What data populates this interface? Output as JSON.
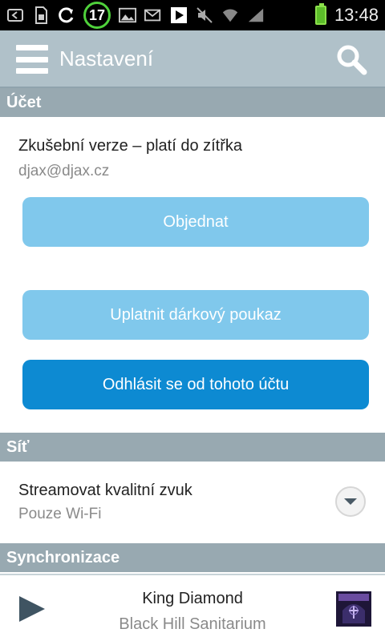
{
  "status_bar": {
    "badge": "17",
    "time": "13:48"
  },
  "app_bar": {
    "title": "Nastavení"
  },
  "sections": {
    "account": {
      "header": "Účet",
      "plan": "Zkušební verze – platí do zítřka",
      "email": "djax@djax.cz",
      "order_button": "Objednat",
      "voucher_button": "Uplatnit dárkový poukaz",
      "logout_button": "Odhlásit se od tohoto účtu"
    },
    "network": {
      "header": "Síť",
      "stream_label": "Streamovat kvalitní zvuk",
      "stream_value": "Pouze Wi-Fi"
    },
    "sync": {
      "header": "Synchronizace"
    }
  },
  "player": {
    "title": "King Diamond",
    "artist": "Black Hill Sanitarium"
  },
  "colors": {
    "app_bar": "#b0c1c9",
    "section_header": "#98a9b1",
    "button_light": "#80c8ec",
    "button_dark": "#0d8ad2"
  }
}
